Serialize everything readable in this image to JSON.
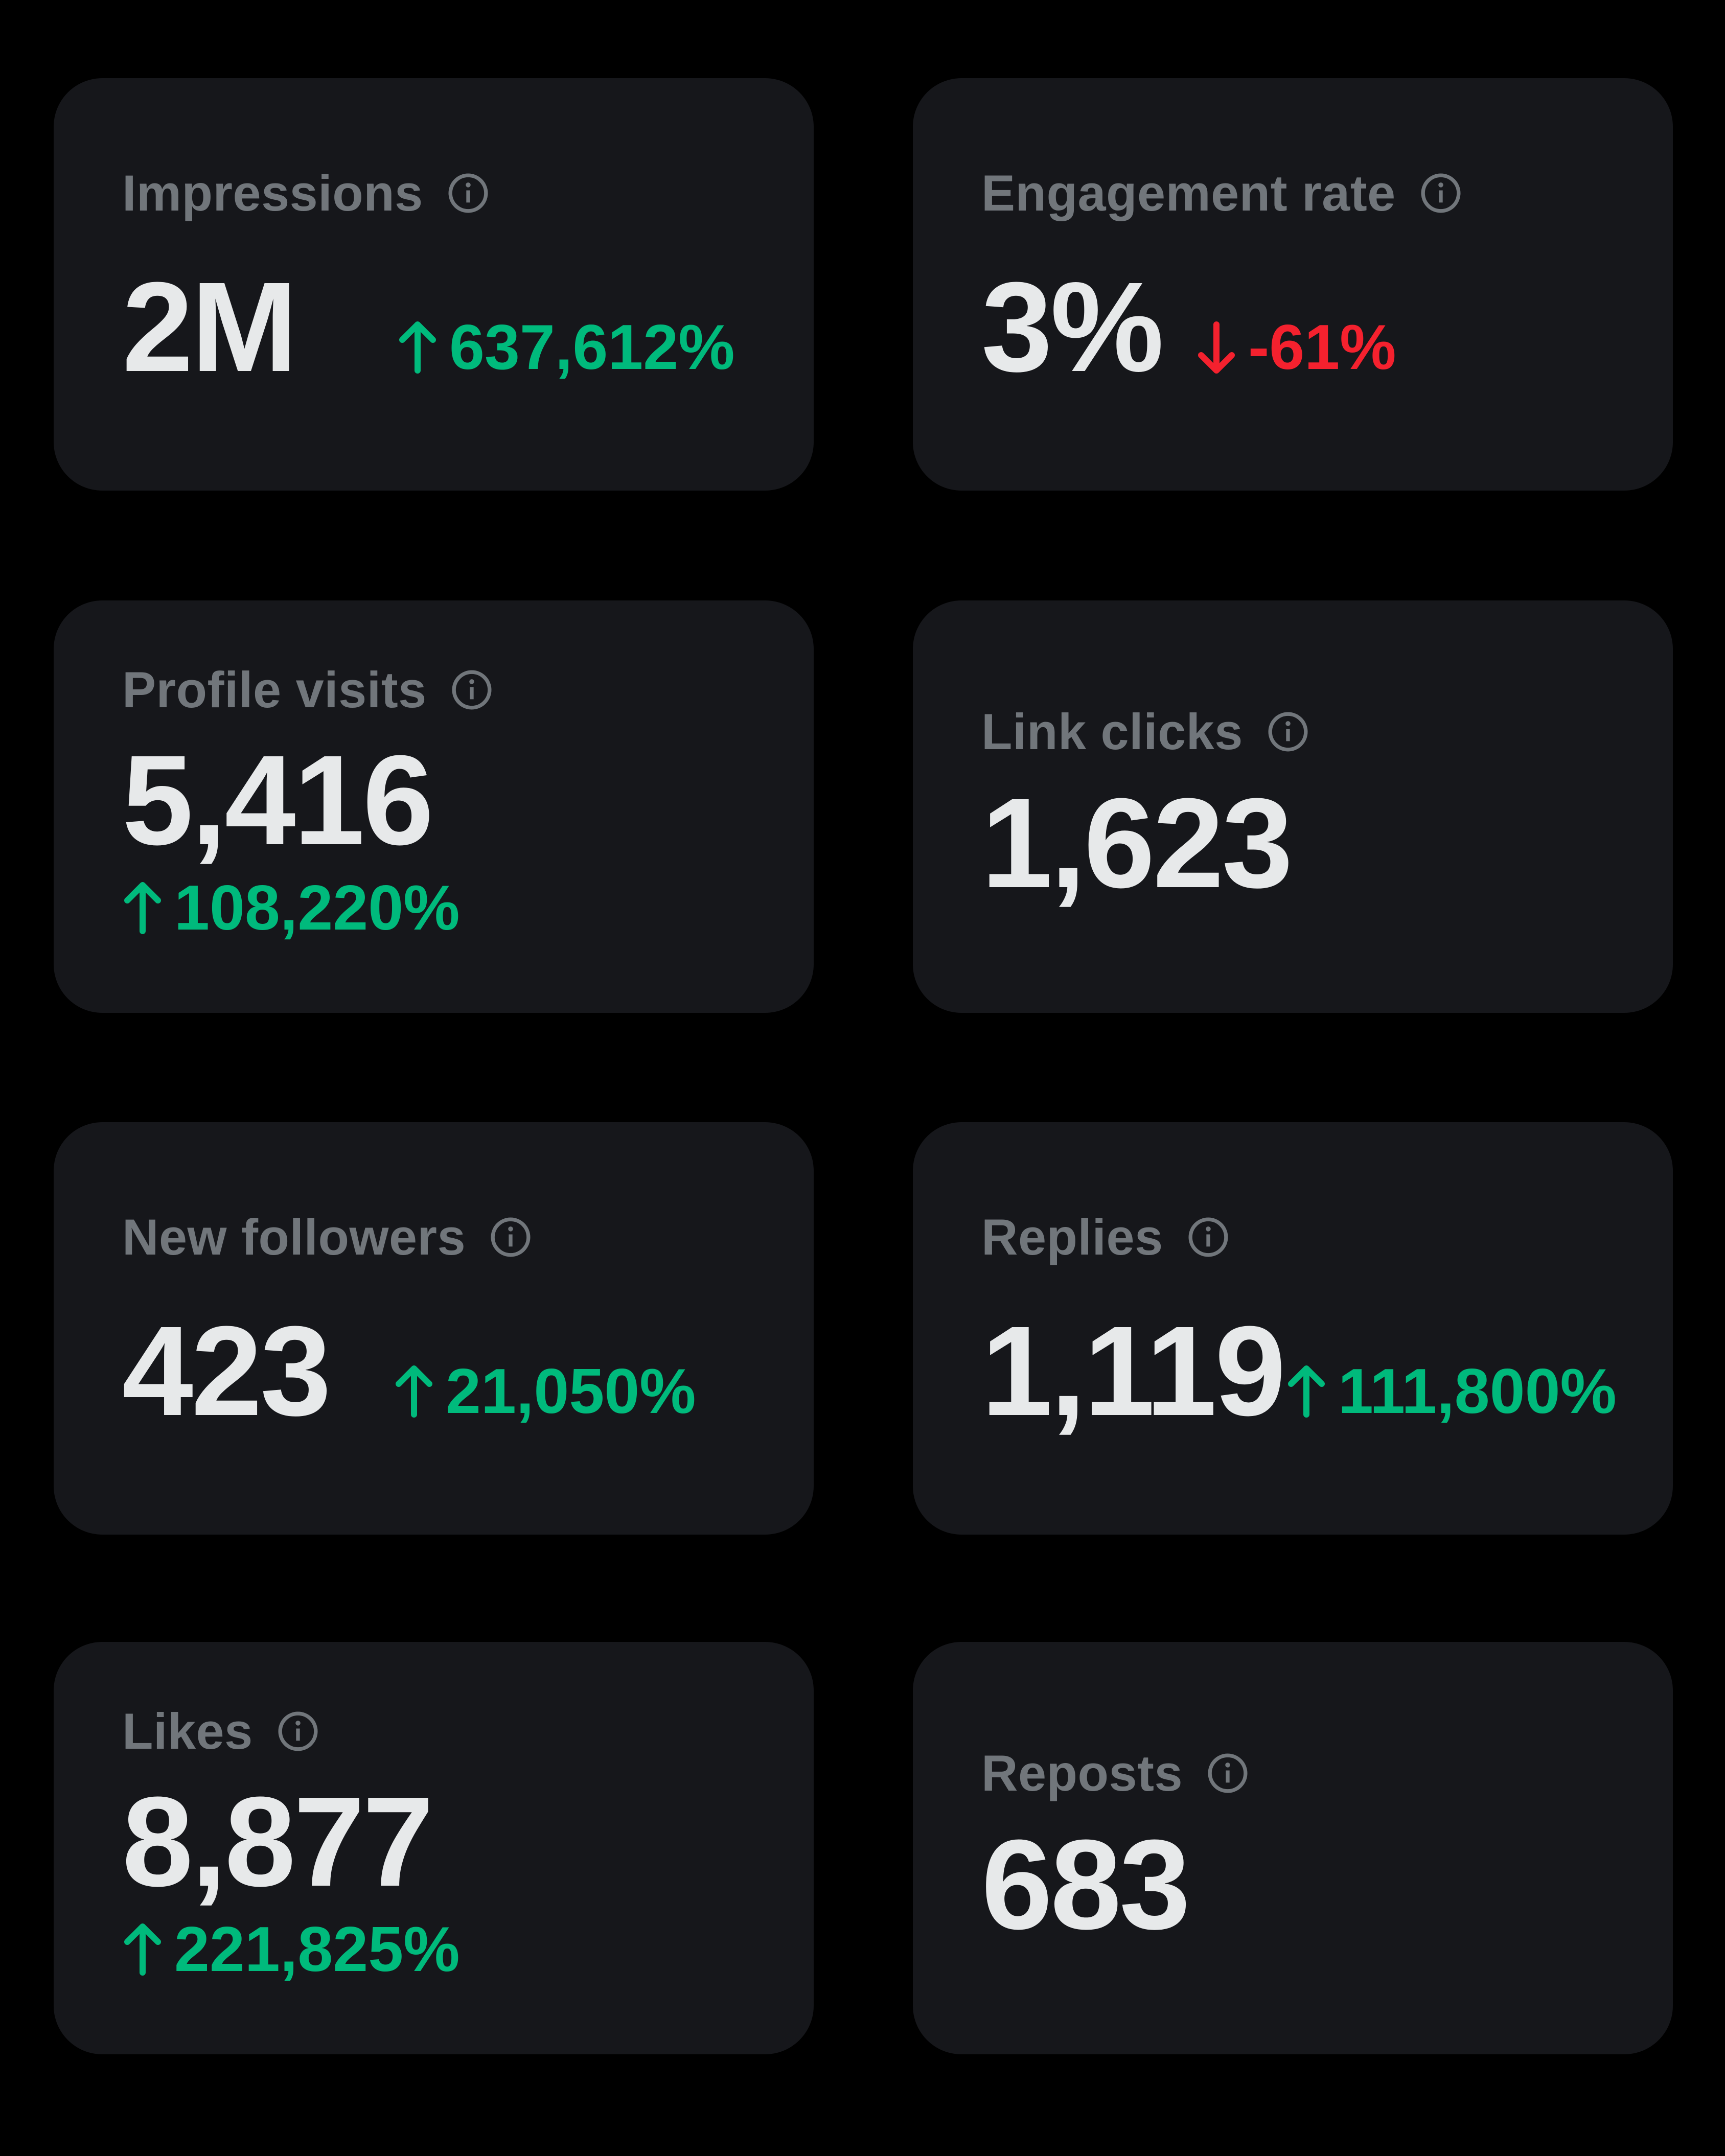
{
  "colors": {
    "background": "#000000",
    "card": "#16171b",
    "label": "#71767b",
    "value": "#e7e9ea",
    "positive": "#00ba7c",
    "negative": "#f4212e"
  },
  "metrics": [
    {
      "label": "Impressions",
      "value": "2M",
      "change": "637,612%",
      "direction": "up",
      "info_icon": "info-icon"
    },
    {
      "label": "Engagement rate",
      "value": "3%",
      "change": "-61%",
      "direction": "down",
      "info_icon": "info-icon"
    },
    {
      "label": "Profile visits",
      "value": "5,416",
      "change": "108,220%",
      "direction": "up",
      "info_icon": "info-icon"
    },
    {
      "label": "Link clicks",
      "value": "1,623",
      "info_icon": "info-icon"
    },
    {
      "label": "New followers",
      "value": "423",
      "change": "21,050%",
      "direction": "up",
      "info_icon": "info-icon"
    },
    {
      "label": "Replies",
      "value": "1,119",
      "change": "111,800%",
      "direction": "up",
      "info_icon": "info-icon"
    },
    {
      "label": "Likes",
      "value": "8,877",
      "change": "221,825%",
      "direction": "up",
      "info_icon": "info-icon"
    },
    {
      "label": "Reposts",
      "value": "683",
      "info_icon": "info-icon"
    }
  ]
}
